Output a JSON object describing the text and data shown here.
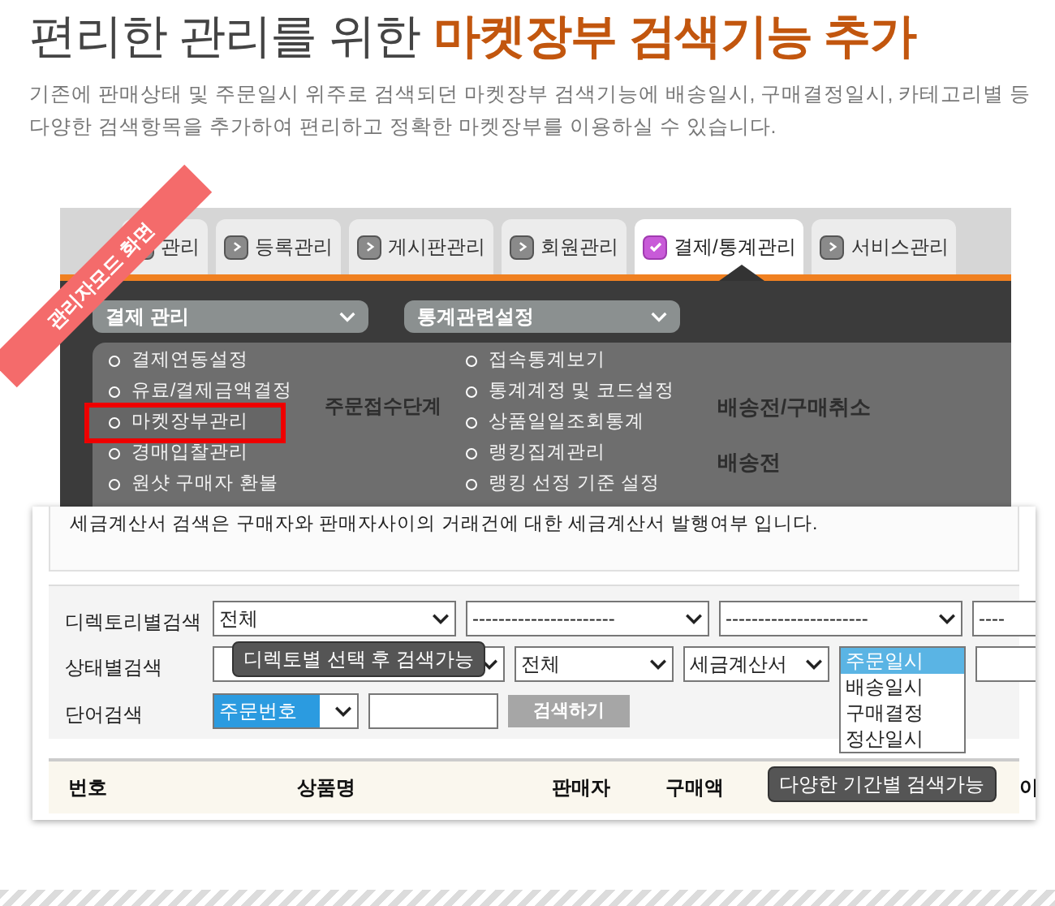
{
  "heading": {
    "plain": "편리한 관리를 위한",
    "highlight": "마켓장부 검색기능 추가"
  },
  "description_lines": [
    "기존에 판매상태 및 주문일시 위주로 검색되던 마켓장부 검색기능에 배송일시, 구매결정일시, 카테고리별 등",
    "다양한 검색항목을 추가하여 편리하고 정확한 마켓장부를 이용하실 수 있습니다."
  ],
  "admin_screen": {
    "ribbon": "관리자모드 화면",
    "tabs": [
      {
        "label": "관리",
        "selected": false
      },
      {
        "label": "등록관리",
        "selected": false
      },
      {
        "label": "게시판관리",
        "selected": false
      },
      {
        "label": "회원관리",
        "selected": false
      },
      {
        "label": "결제/통계관리",
        "selected": true
      },
      {
        "label": "서비스관리",
        "selected": false
      }
    ],
    "menus": [
      {
        "title": "결제 관리",
        "items": [
          {
            "label": "결제연동설정",
            "highlighted": false
          },
          {
            "label": "유료/결제금액결정",
            "highlighted": false
          },
          {
            "label": "마켓장부관리",
            "highlighted": true
          },
          {
            "label": "경매입찰관리",
            "highlighted": false
          },
          {
            "label": "원샷 구매자 환불",
            "highlighted": false
          }
        ]
      },
      {
        "title": "통계관련설정",
        "items": [
          {
            "label": "접속통계보기",
            "highlighted": false
          },
          {
            "label": "통계계정 및 코드설정",
            "highlighted": false
          },
          {
            "label": "상품일일조회통계",
            "highlighted": false
          },
          {
            "label": "랭킹집계관리",
            "highlighted": false
          },
          {
            "label": "랭킹 선정 기준 설정",
            "highlighted": false
          }
        ]
      }
    ],
    "background_texts": [
      "주문접수단계",
      "배송전/구매취소",
      "배송전"
    ]
  },
  "search_screen": {
    "notice": "세금계산서 검색은 구매자와 판매자사이의 거래건에 대한 세금계산서 발행여부 입니다.",
    "rows": [
      {
        "label": "디렉토리별검색",
        "controls": [
          {
            "kind": "select",
            "value": "전체"
          },
          {
            "kind": "select",
            "value": "----------------------"
          },
          {
            "kind": "select",
            "value": "----------------------"
          },
          {
            "kind": "select",
            "value": "----"
          }
        ]
      },
      {
        "label": "상태별검색",
        "controls": [
          {
            "kind": "select"
          },
          {
            "kind": "select",
            "value": "전체"
          },
          {
            "kind": "select",
            "value": "세금계산서"
          },
          {
            "kind": "listbox",
            "options": [
              {
                "label": "주문일시",
                "selected": true
              },
              {
                "label": "배송일시",
                "selected": false
              },
              {
                "label": "구매결정",
                "selected": false
              },
              {
                "label": "정산일시",
                "selected": false
              }
            ]
          },
          {
            "kind": "input"
          }
        ]
      },
      {
        "label": "단어검색",
        "controls": [
          {
            "kind": "select",
            "value": "주문번호",
            "focused": true
          },
          {
            "kind": "input"
          },
          {
            "kind": "button",
            "label": "검색하기"
          }
        ]
      }
    ],
    "tooltips": [
      "디렉토별 선택 후 검색가능",
      "다양한 기간별 검색가능"
    ],
    "columns": [
      "번호",
      "상품명",
      "판매자",
      "구매액",
      "이"
    ]
  }
}
